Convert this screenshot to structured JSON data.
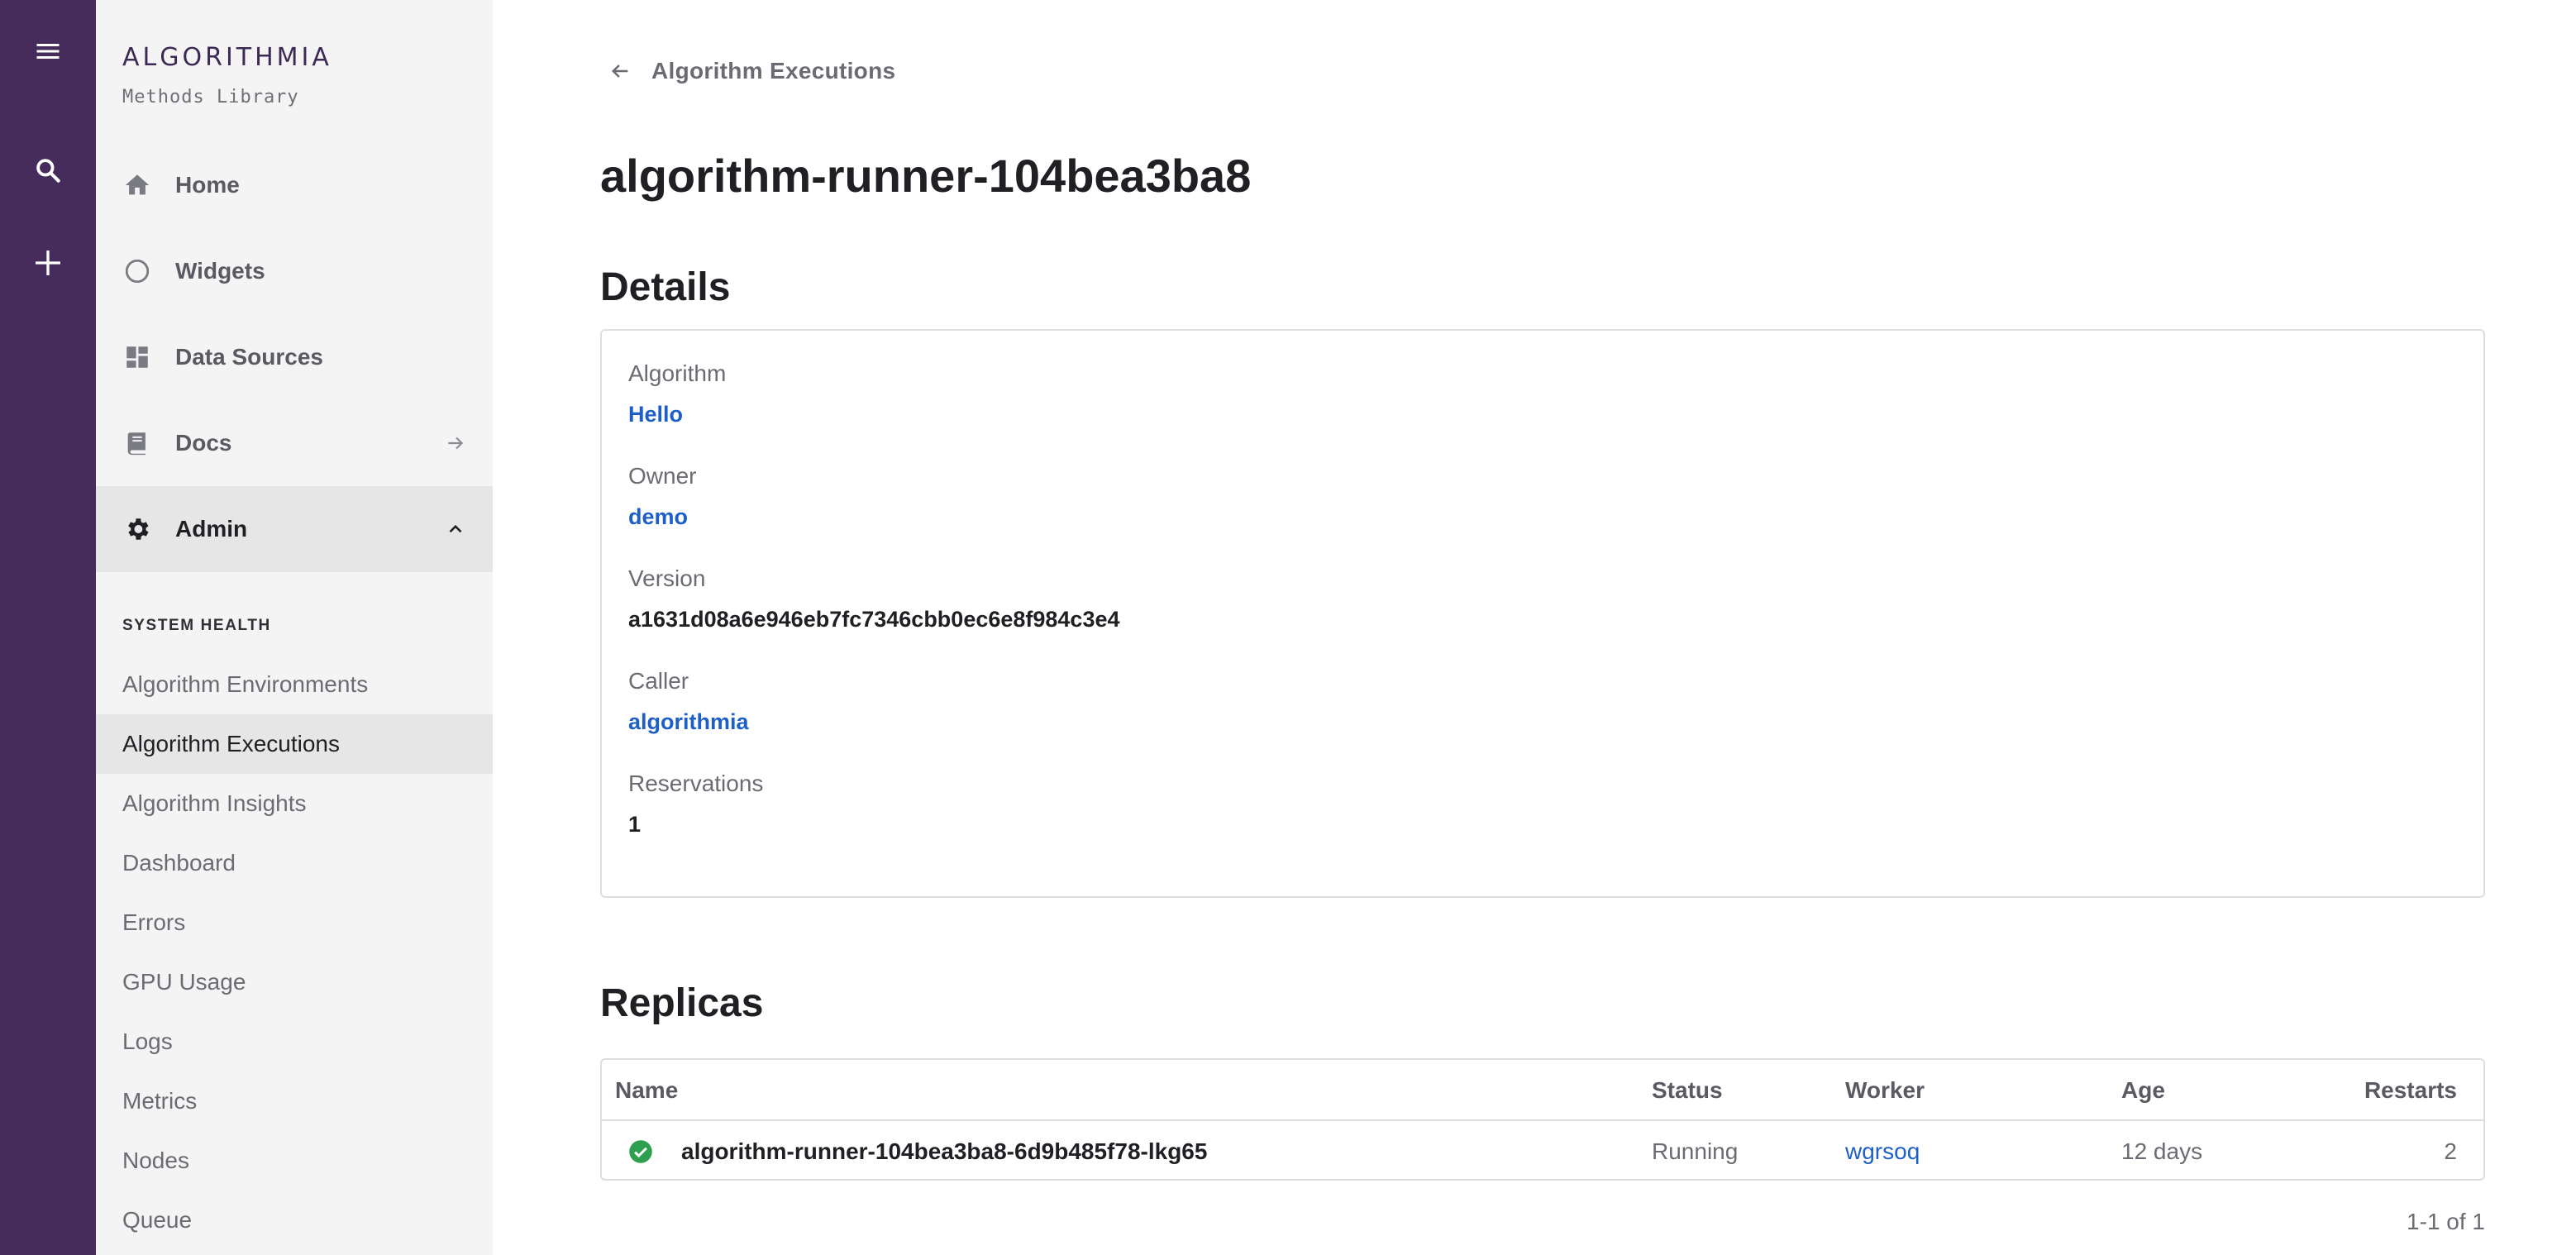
{
  "rail": {
    "icons": [
      "menu-icon",
      "search-icon",
      "plus-icon"
    ]
  },
  "brand": {
    "name": "ALGORITHMIA",
    "subtitle": "Methods Library"
  },
  "sidebar": {
    "nav": [
      {
        "label": "Home",
        "icon": "home-icon"
      },
      {
        "label": "Widgets",
        "icon": "circle-icon"
      },
      {
        "label": "Data Sources",
        "icon": "dashboard-icon"
      },
      {
        "label": "Docs",
        "icon": "book-icon",
        "trail_icon": "arrow-right-icon"
      },
      {
        "label": "Admin",
        "icon": "gear-icon",
        "trail_icon": "chevron-up-icon",
        "expanded": true
      }
    ],
    "section_title": "SYSTEM HEALTH",
    "sub_items": [
      {
        "label": "Algorithm Environments"
      },
      {
        "label": "Algorithm Executions",
        "active": true
      },
      {
        "label": "Algorithm Insights"
      },
      {
        "label": "Dashboard"
      },
      {
        "label": "Errors"
      },
      {
        "label": "GPU Usage"
      },
      {
        "label": "Logs"
      },
      {
        "label": "Metrics"
      },
      {
        "label": "Nodes"
      },
      {
        "label": "Queue"
      }
    ]
  },
  "main": {
    "back_label": "Algorithm Executions",
    "title": "algorithm-runner-104bea3ba8",
    "details_title": "Details",
    "details": [
      {
        "label": "Algorithm",
        "value": "Hello",
        "link": true
      },
      {
        "label": "Owner",
        "value": "demo",
        "link": true
      },
      {
        "label": "Version",
        "value": "a1631d08a6e946eb7fc7346cbb0ec6e8f984c3e4",
        "link": false
      },
      {
        "label": "Caller",
        "value": "algorithmia",
        "link": true
      },
      {
        "label": "Reservations",
        "value": "1",
        "link": false
      }
    ],
    "replicas_title": "Replicas",
    "table": {
      "columns": [
        "Name",
        "Status",
        "Worker",
        "Age",
        "Restarts"
      ],
      "rows": [
        {
          "status_icon": "check-circle-icon",
          "name": "algorithm-runner-104bea3ba8-6d9b485f78-lkg65",
          "status": "Running",
          "worker": "wgrsoq",
          "age": "12 days",
          "restarts": "2"
        }
      ]
    },
    "pagination": "1-1 of 1"
  },
  "colors": {
    "rail_bg": "#452c5c",
    "sidebar_bg": "#f4f4f4",
    "link": "#1e5fc7",
    "success": "#2e9e4f"
  }
}
